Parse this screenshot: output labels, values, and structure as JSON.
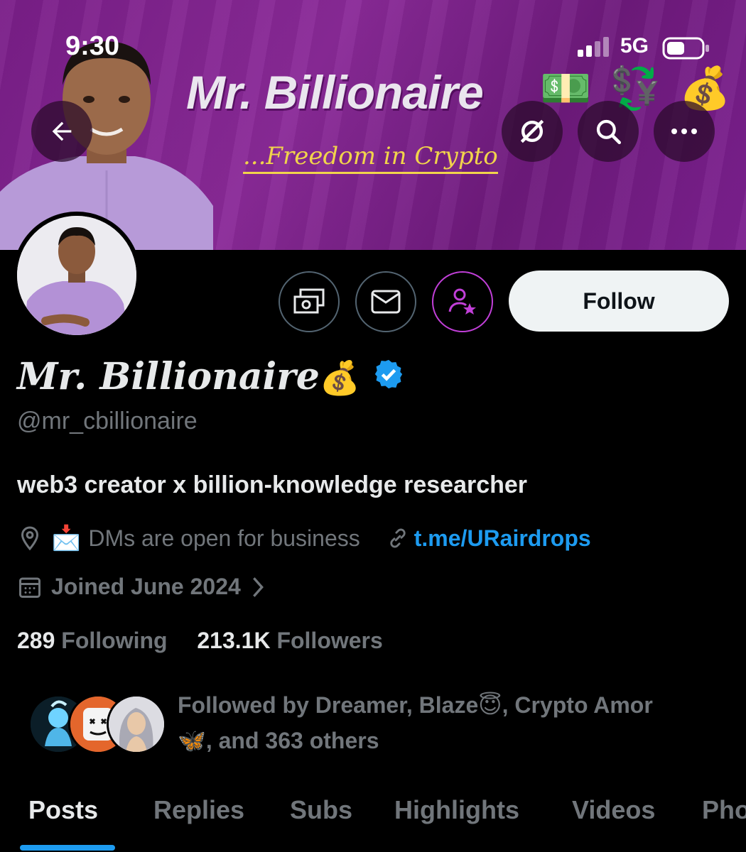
{
  "status_bar": {
    "time": "9:30",
    "network": "5G"
  },
  "banner": {
    "title": "Mr. Billionaire",
    "title_emojis": [
      "💵",
      "💱",
      "💰"
    ],
    "tagline": "...Freedom in Crypto"
  },
  "header_buttons": {
    "back_icon": "arrow-left-icon",
    "grok_icon": "grok-icon",
    "search_icon": "search-icon",
    "more_icon": "more-horizontal-icon"
  },
  "actions": {
    "subscribe_icon": "money-icon",
    "message_icon": "envelope-icon",
    "notify_icon": "person-star-icon",
    "follow_label": "Follow"
  },
  "profile": {
    "name": "Mr. Billionaire",
    "name_emoji": "💰",
    "handle": "@mr_cbillionaire",
    "bio": "web3 creator x billion-knowledge researcher",
    "location_emoji": "📩",
    "location": "DMs are open for business",
    "link": "t.me/URairdrops",
    "joined": "Joined June 2024",
    "following_count": "289",
    "following_label": "Following",
    "followers_count": "213.1K",
    "followers_label": "Followers"
  },
  "followed_by": {
    "line1": "Followed by Dreamer, Blaze😇, Crypto Amor",
    "line2": "🦋, and 363 others"
  },
  "tabs": [
    "Posts",
    "Replies",
    "Subs",
    "Highlights",
    "Videos",
    "Pho"
  ],
  "colors": {
    "accent": "#1d9bf0",
    "banner": "#7d2090",
    "notify_ring": "#c13fd8"
  }
}
